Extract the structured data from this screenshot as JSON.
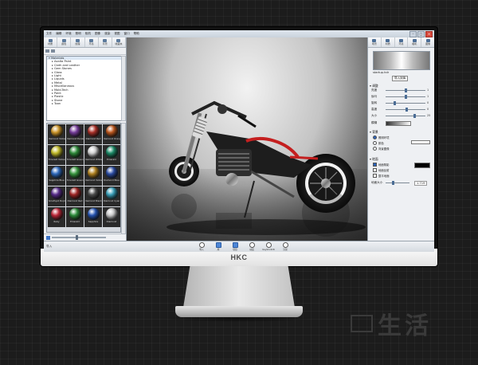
{
  "app": {
    "window_title": "KeyShot",
    "menu": [
      "文件",
      "编辑",
      "环境",
      "照明",
      "相机",
      "图像",
      "渲染",
      "视图",
      "窗口",
      "帮助"
    ]
  },
  "left_panel": {
    "tabs": [
      "材质",
      "颜色",
      "纹理",
      "环境",
      "背景",
      "收藏夹"
    ],
    "tree_items": [
      "Axalta Paint",
      "Cloth and Leather",
      "Gem Stones",
      "Glass",
      "Light",
      "Liquids",
      "Metal",
      "Miscellaneous",
      "Mold-Tech",
      "Paint",
      "Plastic",
      "Stone",
      "Toon"
    ],
    "tree_root": "Materials",
    "materials": [
      {
        "name": "Diamond Yellow",
        "color": "#d29a2a"
      },
      {
        "name": "Diamond Purple",
        "color": "#7a3fa0"
      },
      {
        "name": "Diamond Red",
        "color": "#b0322a"
      },
      {
        "name": "Diamond Orange",
        "color": "#c0591e"
      },
      {
        "name": "Emerald Yellow",
        "color": "#c7c02a"
      },
      {
        "name": "Emerald Green",
        "color": "#2f8e3b"
      },
      {
        "name": "Diamond White",
        "color": "#d7d7d7"
      },
      {
        "name": "Emerald",
        "color": "#1d8e6a"
      },
      {
        "name": "Sapphire Blue",
        "color": "#2e6bc0"
      },
      {
        "name": "Emerald Green",
        "color": "#3a9b41"
      },
      {
        "name": "Diamond Yellow",
        "color": "#b58520"
      },
      {
        "name": "Diamond Blue",
        "color": "#2c4ea6"
      },
      {
        "name": "Amethyst Purple",
        "color": "#5a2d8e"
      },
      {
        "name": "Diamond Red",
        "color": "#a32727"
      },
      {
        "name": "Diamond Black",
        "color": "#505050"
      },
      {
        "name": "Diamond Cyan",
        "color": "#3aa3bd"
      },
      {
        "name": "Ruby",
        "color": "#c2283a"
      },
      {
        "name": "Emerald",
        "color": "#2d8f3c"
      },
      {
        "name": "Sapphire",
        "color": "#2555b5"
      },
      {
        "name": "Diamond",
        "color": "#cccccc"
      }
    ]
  },
  "right_panel": {
    "tabs": [
      "场景",
      "材质",
      "环境",
      "相机",
      "图像"
    ],
    "env_name": "startup.hdr",
    "env_button": "导入到库",
    "adjust_header": "调整",
    "sliders": [
      {
        "label": "亮度",
        "value": "1"
      },
      {
        "label": "伽马",
        "value": "1"
      },
      {
        "label": "旋转",
        "value": "0"
      },
      {
        "label": "高度",
        "value": "0"
      },
      {
        "label": "大小",
        "value": "25"
      }
    ],
    "blur_label": "模糊",
    "background_header": "背景",
    "background_options": [
      "照明环境",
      "颜色",
      "背景图像"
    ],
    "ground_header": "地面",
    "ground_options": [
      "地面阴影",
      "地面反射",
      "整平地面"
    ],
    "ground_size_label": "地面大小",
    "ground_size_value": "1.719"
  },
  "bottom_bar": {
    "left_label": "导入",
    "tools": [
      "导入",
      "库",
      "项目",
      "动画",
      "KeyShotVR",
      "渲染"
    ]
  },
  "monitor": {
    "brand": "HKC"
  },
  "watermark": {
    "text": "生活"
  }
}
